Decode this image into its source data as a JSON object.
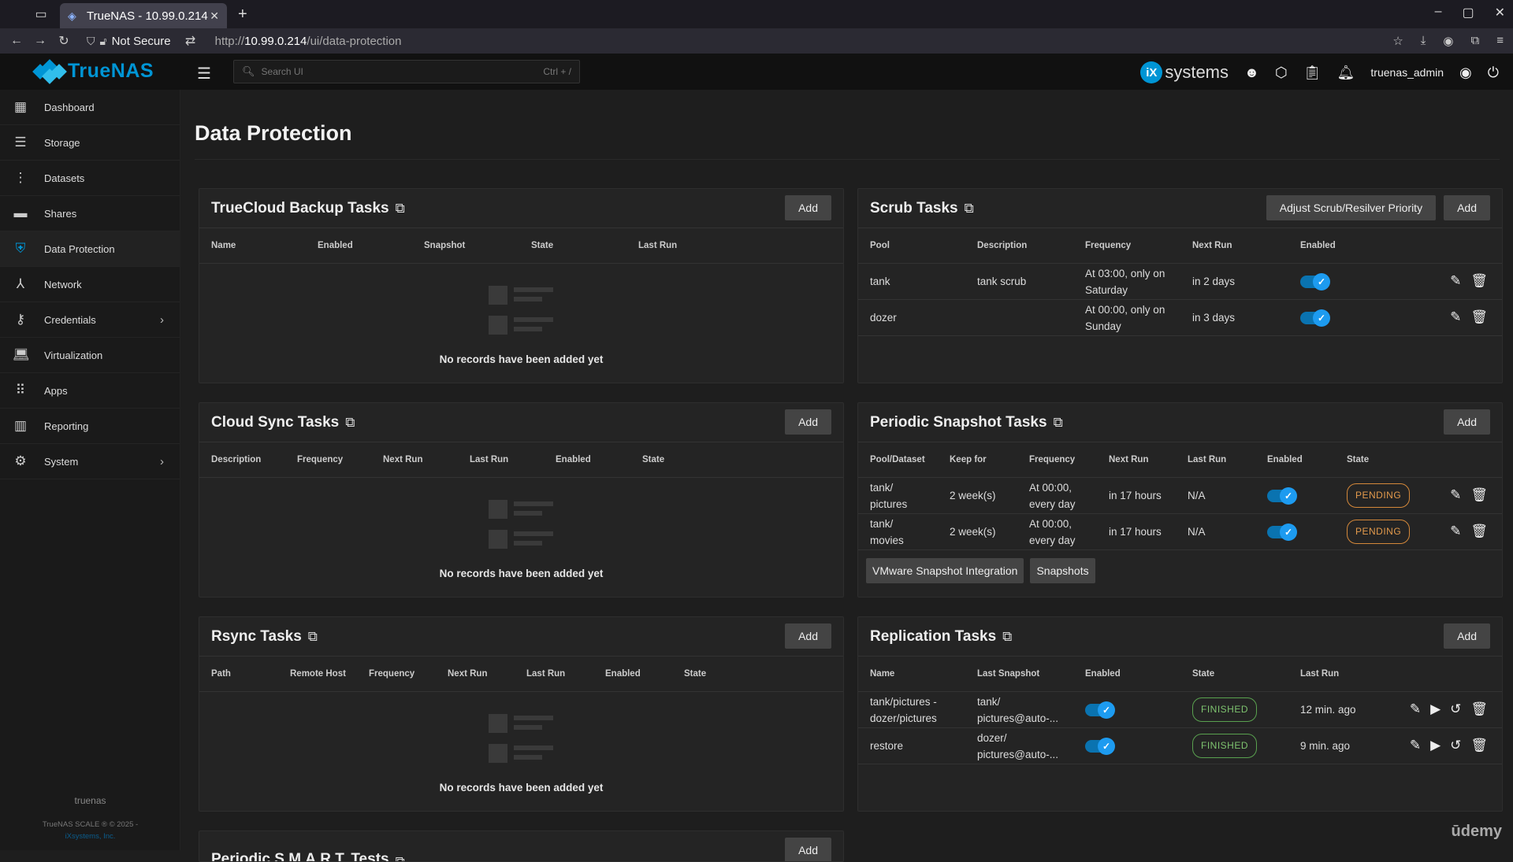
{
  "browser": {
    "tab_title": "TrueNAS - 10.99.0.214",
    "security_label": "Not Secure",
    "url_prefix": "http://",
    "url_host": "10.99.0.214",
    "url_path": "/ui/data-protection"
  },
  "topbar": {
    "brand": "TrueNAS",
    "search_placeholder": "Search UI",
    "search_shortcut": "Ctrl + /",
    "partner_badge": "iX",
    "partner_name": "systems",
    "username": "truenas_admin"
  },
  "sidebar": {
    "items": [
      {
        "label": "Dashboard",
        "icon": "dashboard-icon"
      },
      {
        "label": "Storage",
        "icon": "storage-icon"
      },
      {
        "label": "Datasets",
        "icon": "datasets-icon"
      },
      {
        "label": "Shares",
        "icon": "shares-icon"
      },
      {
        "label": "Data Protection",
        "icon": "shield-icon"
      },
      {
        "label": "Network",
        "icon": "network-icon"
      },
      {
        "label": "Credentials",
        "icon": "key-icon"
      },
      {
        "label": "Virtualization",
        "icon": "laptop-icon"
      },
      {
        "label": "Apps",
        "icon": "apps-icon"
      },
      {
        "label": "Reporting",
        "icon": "reporting-icon"
      },
      {
        "label": "System",
        "icon": "gear-icon"
      }
    ],
    "hostname": "truenas",
    "copyright": "TrueNAS SCALE ® © 2025 -",
    "company": "iXsystems, Inc."
  },
  "page": {
    "title": "Data Protection"
  },
  "truecloud": {
    "title": "TrueCloud Backup Tasks",
    "add": "Add",
    "columns": [
      "Name",
      "Enabled",
      "Snapshot",
      "State",
      "Last Run"
    ],
    "empty": "No records have been added yet"
  },
  "cloudsync": {
    "title": "Cloud Sync Tasks",
    "add": "Add",
    "columns": [
      "Description",
      "Frequency",
      "Next Run",
      "Last Run",
      "Enabled",
      "State"
    ],
    "empty": "No records have been added yet"
  },
  "rsync": {
    "title": "Rsync Tasks",
    "add": "Add",
    "columns": [
      "Path",
      "Remote Host",
      "Frequency",
      "Next Run",
      "Last Run",
      "Enabled",
      "State"
    ],
    "empty": "No records have been added yet"
  },
  "smart": {
    "title": "Periodic S.M.A.R.T. Tests",
    "add": "Add"
  },
  "scrub": {
    "title": "Scrub Tasks",
    "priority_btn": "Adjust Scrub/Resilver Priority",
    "add": "Add",
    "columns": [
      "Pool",
      "Description",
      "Frequency",
      "Next Run",
      "Enabled"
    ],
    "rows": [
      {
        "pool": "tank",
        "description": "tank scrub",
        "frequency": "At 03:00, only on Saturday",
        "next_run": "in 2 days"
      },
      {
        "pool": "dozer",
        "description": "",
        "frequency": "At 00:00, only on Sunday",
        "next_run": "in 3 days"
      }
    ]
  },
  "snapshot": {
    "title": "Periodic Snapshot Tasks",
    "add": "Add",
    "columns": [
      "Pool/Dataset",
      "Keep for",
      "Frequency",
      "Next Run",
      "Last Run",
      "Enabled",
      "State"
    ],
    "rows": [
      {
        "dataset": "tank/ pictures",
        "keep": "2 week(s)",
        "frequency": "At 00:00, every day",
        "next_run": "in 17 hours",
        "last_run": "N/A",
        "state": "PENDING"
      },
      {
        "dataset": "tank/ movies",
        "keep": "2 week(s)",
        "frequency": "At 00:00, every day",
        "next_run": "in 17 hours",
        "last_run": "N/A",
        "state": "PENDING"
      }
    ],
    "vmware_btn": "VMware Snapshot Integration",
    "snapshots_btn": "Snapshots"
  },
  "replication": {
    "title": "Replication Tasks",
    "add": "Add",
    "columns": [
      "Name",
      "Last Snapshot",
      "Enabled",
      "State",
      "Last Run"
    ],
    "rows": [
      {
        "name": "tank/pictures - dozer/pictures",
        "last_snapshot": "tank/ pictures@auto-...",
        "state": "FINISHED",
        "last_run": "12 min. ago"
      },
      {
        "name": "restore",
        "last_snapshot": "dozer/ pictures@auto-...",
        "state": "FINISHED",
        "last_run": "9 min. ago"
      }
    ]
  },
  "watermark": "ūdemy"
}
